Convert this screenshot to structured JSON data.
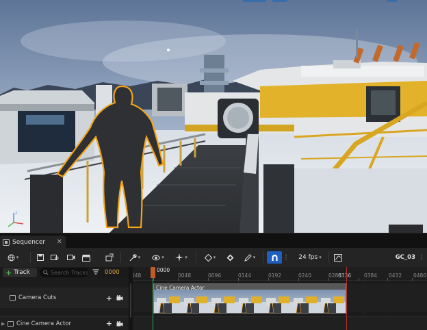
{
  "panel": {
    "tab_label": "Sequencer",
    "tab_close": "✕"
  },
  "toolbar": {
    "fps_label": "24 fps",
    "sequence_name": "GC_03",
    "snapping_enabled": true,
    "accent": "#1f5fbf"
  },
  "outliner": {
    "add_track_label": "Track",
    "search_placeholder": "Search Tracks",
    "current_frame": "0000",
    "tracks": [
      {
        "label": "Camera Cuts"
      },
      {
        "label": "Cine Camera Actor"
      }
    ]
  },
  "timeline": {
    "playhead_label": "0000",
    "section_title": "Cine Camera Actor",
    "ruler_labels": [
      "048",
      "0000",
      "0048",
      "0096",
      "0144",
      "0192",
      "0240",
      "0288",
      "0336",
      "0384",
      "0432",
      "0480"
    ],
    "playhead_color": "#c15b2b",
    "end_marker_color": "#b3302a"
  }
}
